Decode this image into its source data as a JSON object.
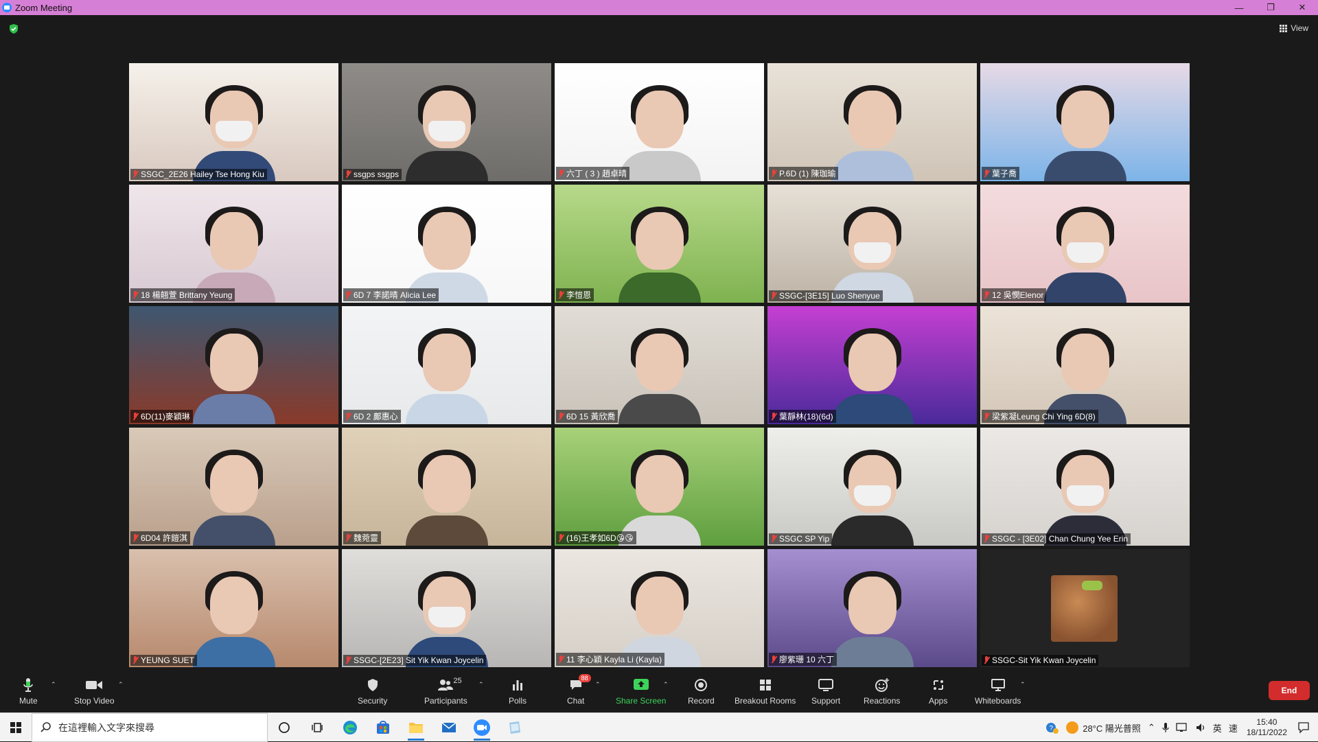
{
  "window": {
    "title": "Zoom Meeting",
    "minimize": "—",
    "maximize": "❐",
    "close": "✕"
  },
  "view_button": {
    "label": "View"
  },
  "participants": [
    {
      "name": "SSGC_2E26 Hailey Tse Hong Kiu",
      "bg": "#d9c9c0",
      "top": "#f5f1ea",
      "shirt": "#324a78",
      "mask": true
    },
    {
      "name": "ssgps ssgps",
      "bg": "#6f6d6a",
      "top": "#8f8c88",
      "shirt": "#2d2d2d",
      "mask": true,
      "active": true
    },
    {
      "name": "六丁 ( 3 ) 趙卓晴",
      "bg": "#f3f3f3",
      "top": "#ffffff",
      "shirt": "#c9c9c9",
      "mask": false
    },
    {
      "name": "P.6D (1) 陳珈瑜",
      "bg": "#cfc4b6",
      "top": "#e9e2d8",
      "shirt": "#aebfdc",
      "mask": false
    },
    {
      "name": "葉子喬",
      "bg": "#7cb4e8",
      "top": "#e7d9e6",
      "shirt": "#3a4c6e",
      "mask": false
    },
    {
      "name": "18 楊翹萱 Brittany Yeung",
      "bg": "#d8c9d2",
      "top": "#efe6ea",
      "shirt": "#c8a9b8",
      "mask": false
    },
    {
      "name": "6D 7 李諾晴 Alicia Lee",
      "bg": "#f7f7f7",
      "top": "#ffffff",
      "shirt": "#cfd9e6",
      "mask": false
    },
    {
      "name": "李愷恩",
      "bg": "#7fb250",
      "top": "#b7d98a",
      "shirt": "#3b6a2a",
      "mask": false
    },
    {
      "name": "SSGC-[3E15] Luo Shenyue",
      "bg": "#bdb3a6",
      "top": "#e7e0d6",
      "shirt": "#d0d8e4",
      "mask": true
    },
    {
      "name": "12 吳憫Elenor",
      "bg": "#e8c4c7",
      "top": "#f3dcde",
      "shirt": "#32446a",
      "mask": true
    },
    {
      "name": "6D(11)麥穎琳",
      "bg": "#8a3a2a",
      "top": "#3e5770",
      "shirt": "#6a7da8",
      "mask": false
    },
    {
      "name": "6D 2 鄺惠心",
      "bg": "#e7e9ea",
      "top": "#f3f4f5",
      "shirt": "#c9d6e6",
      "mask": false
    },
    {
      "name": "6D 15 黃欣喬",
      "bg": "#c9c3ba",
      "top": "#e1dcd5",
      "shirt": "#4a4a4a",
      "mask": false
    },
    {
      "name": "葉靜林(18)(6d)",
      "bg": "#4a2a9a",
      "top": "#c53fd3",
      "shirt": "#2d4a7a",
      "mask": false
    },
    {
      "name": "梁紫凝Leung Chi Ying 6D(8)",
      "bg": "#d4c7b8",
      "top": "#ece3d8",
      "shirt": "#44506a",
      "mask": false
    },
    {
      "name": "6D04 許鎧淇",
      "bg": "#b9a08c",
      "top": "#d9c9b8",
      "shirt": "#44506a",
      "mask": false
    },
    {
      "name": "魏菀靈",
      "bg": "#c7b59a",
      "top": "#e0d1b9",
      "shirt": "#5d4a3a",
      "mask": false
    },
    {
      "name": "(16)王孝如6D😘😘",
      "bg": "#5f9f3f",
      "top": "#a8d17a",
      "shirt": "#d9d9d9",
      "mask": false
    },
    {
      "name": "SSGC SP Yip",
      "bg": "#c8c9c4",
      "top": "#eeeeea",
      "shirt": "#2a2a2a",
      "mask": true
    },
    {
      "name": "SSGC - [3E02] Chan Chung Yee Erin",
      "bg": "#d6d2ce",
      "top": "#ebe8e5",
      "shirt": "#2d2d3a",
      "mask": true
    },
    {
      "name": "YEUNG SUET",
      "bg": "#b7896d",
      "top": "#d9c0ad",
      "shirt": "#3d6fa5",
      "mask": false
    },
    {
      "name": "SSGC-[2E23] Sit Yik Kwan Joycelin",
      "bg": "#b8b6b4",
      "top": "#e0dedb",
      "shirt": "#2d4a7a",
      "mask": true
    },
    {
      "name": "11 李心穎 Kayla Li (Kayla)",
      "bg": "#d5cfc7",
      "top": "#ebe6e0",
      "shirt": "#cfd6df",
      "mask": false
    },
    {
      "name": "廖紫珊 10 六丁",
      "bg": "#5b4a8a",
      "top": "#a58fd0",
      "shirt": "#6d7d96",
      "mask": false
    },
    {
      "name": "SSGC-Sit Yik Kwan Joycelin",
      "bg": "#232323",
      "top": "#232323",
      "shirt": "#232323",
      "avatar": true
    }
  ],
  "toolbar": {
    "mute": "Mute",
    "stop_video": "Stop Video",
    "security": "Security",
    "participants": "Participants",
    "participants_count": "25",
    "polls": "Polls",
    "chat": "Chat",
    "chat_badge": "88",
    "share_screen": "Share Screen",
    "record": "Record",
    "breakout_rooms": "Breakout Rooms",
    "support": "Support",
    "reactions": "Reactions",
    "apps": "Apps",
    "whiteboards": "Whiteboards",
    "end": "End"
  },
  "taskbar": {
    "search_placeholder": "在這裡輸入文字來搜尋",
    "weather": "28°C 陽光普照",
    "ime_lang": "英",
    "ime_mode": "速",
    "time": "15:40",
    "date": "18/11/2022"
  },
  "colors": {
    "titlebar": "#d67fd6",
    "share_green": "#3dd35a",
    "end_red": "#d22c2c",
    "active_speaker": "#e6e88a"
  }
}
